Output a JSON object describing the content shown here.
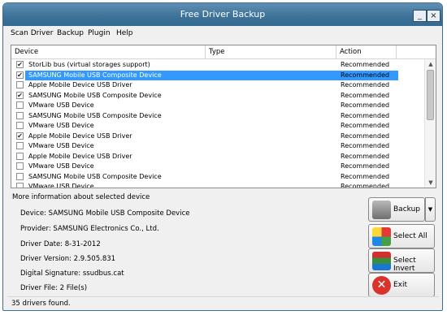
{
  "window": {
    "title": "Free Driver Backup",
    "minimize_glyph": "_",
    "close_glyph": "×"
  },
  "menu": [
    "Scan Driver",
    "Backup",
    "Plugin",
    "Help"
  ],
  "table": {
    "columns": [
      "Device",
      "Type",
      "Action"
    ],
    "rows": [
      {
        "checked": true,
        "device": "StorLib bus (virtual storages support)",
        "action": "Recommended",
        "selected": false
      },
      {
        "checked": true,
        "device": "SAMSUNG Mobile USB Composite Device",
        "action": "Recommended",
        "selected": true
      },
      {
        "checked": false,
        "device": "Apple Mobile Device USB Driver",
        "action": "Recommended",
        "selected": false
      },
      {
        "checked": true,
        "device": "SAMSUNG Mobile USB Composite Device",
        "action": "Recommended",
        "selected": false
      },
      {
        "checked": false,
        "device": "VMware USB Device",
        "action": "Recommended",
        "selected": false
      },
      {
        "checked": false,
        "device": "SAMSUNG Mobile USB Composite Device",
        "action": "Recommended",
        "selected": false
      },
      {
        "checked": false,
        "device": "VMware USB Device",
        "action": "Recommended",
        "selected": false
      },
      {
        "checked": true,
        "device": "Apple Mobile Device USB Driver",
        "action": "Recommended",
        "selected": false
      },
      {
        "checked": false,
        "device": "VMware USB Device",
        "action": "Recommended",
        "selected": false
      },
      {
        "checked": false,
        "device": "Apple Mobile Device USB Driver",
        "action": "Recommended",
        "selected": false
      },
      {
        "checked": false,
        "device": "VMware USB Device",
        "action": "Recommended",
        "selected": false
      },
      {
        "checked": false,
        "device": "SAMSUNG Mobile USB Composite Device",
        "action": "Recommended",
        "selected": false
      },
      {
        "checked": false,
        "device": "VMware USB Device",
        "action": "Recommended",
        "selected": false
      }
    ]
  },
  "info": {
    "title": "More information about selected device",
    "lines": [
      "Device:  SAMSUNG Mobile USB Composite Device",
      "Provider: SAMSUNG Electronics Co., Ltd.",
      "Driver Date: 8-31-2012",
      "Driver Version: 2.9.505.831",
      "Digital Signature: ssudbus.cat",
      "Driver File: 2 File(s)"
    ]
  },
  "buttons": {
    "backup": "Backup",
    "select_all": "Select All",
    "select_invert": "Select Invert",
    "exit": "Exit",
    "dropdown_glyph": "▼"
  },
  "scroll_glyphs": {
    "up": "▲",
    "down": "▼"
  },
  "status": "35 drivers found.",
  "colors": {
    "title_bar": "#3f7398",
    "selection": "#3399ff",
    "exit_red": "#d9342b"
  },
  "icons": {
    "backup": "drive-backup-icon",
    "select_all": "multi-color-grid-icon",
    "select_invert": "colored-stack-icon",
    "exit": "red-x-icon"
  }
}
